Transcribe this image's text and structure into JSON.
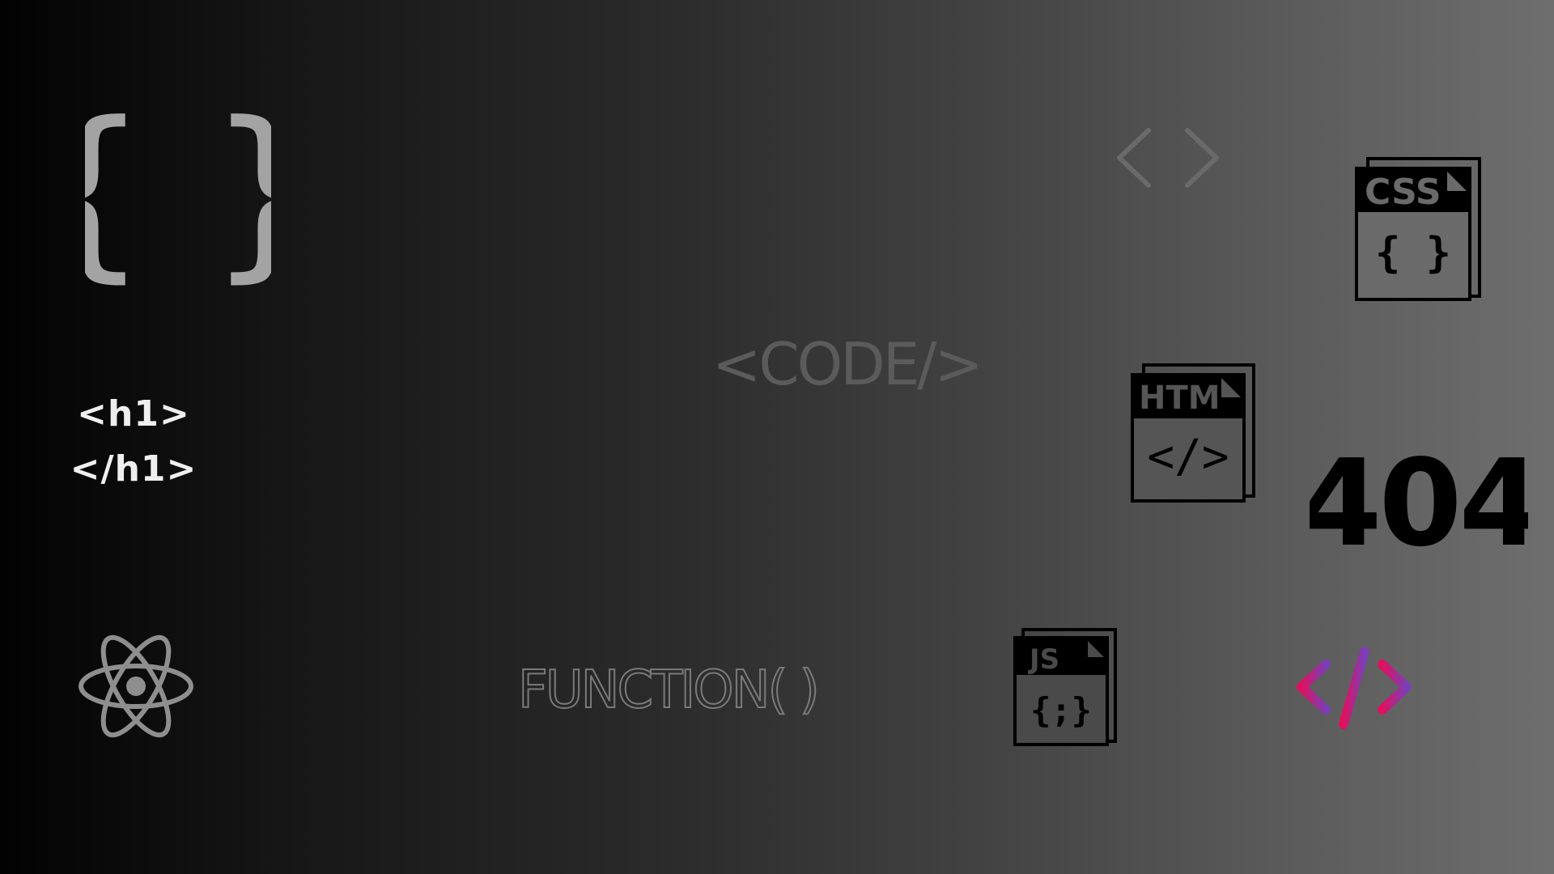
{
  "colors": {
    "background_left": "#020202",
    "background_right": "#6e6e6e",
    "braces": "#a3a3a3",
    "h1_text": "#efefef",
    "atom": "#8e8e8e",
    "code_text": "#5b5b5b",
    "function_text": "#7a7a7a",
    "chevrons": "#6a6a6a",
    "file_icons": "#000000",
    "e404": "#000000",
    "grad_start": "#e0115f",
    "grad_end": "#7a3fb8"
  },
  "icons": {
    "braces": "curly-braces-icon",
    "atom": "react-atom-icon",
    "chevrons": "angle-brackets-icon",
    "css_file": "css-file-icon",
    "html_file": "html-file-icon",
    "js_file": "js-file-icon",
    "code": "code-slash-icon"
  },
  "h1_tags": {
    "open": "<h1>",
    "close": "</h1>"
  },
  "code_label": "<CODE/>",
  "function_label": "FUNCTION( )",
  "files": {
    "css": {
      "label": "CSS",
      "body": "{ }"
    },
    "html": {
      "label": "HTM",
      "body": "</>"
    },
    "js": {
      "label": "JS",
      "body": "{;}"
    }
  },
  "error_code": "404"
}
